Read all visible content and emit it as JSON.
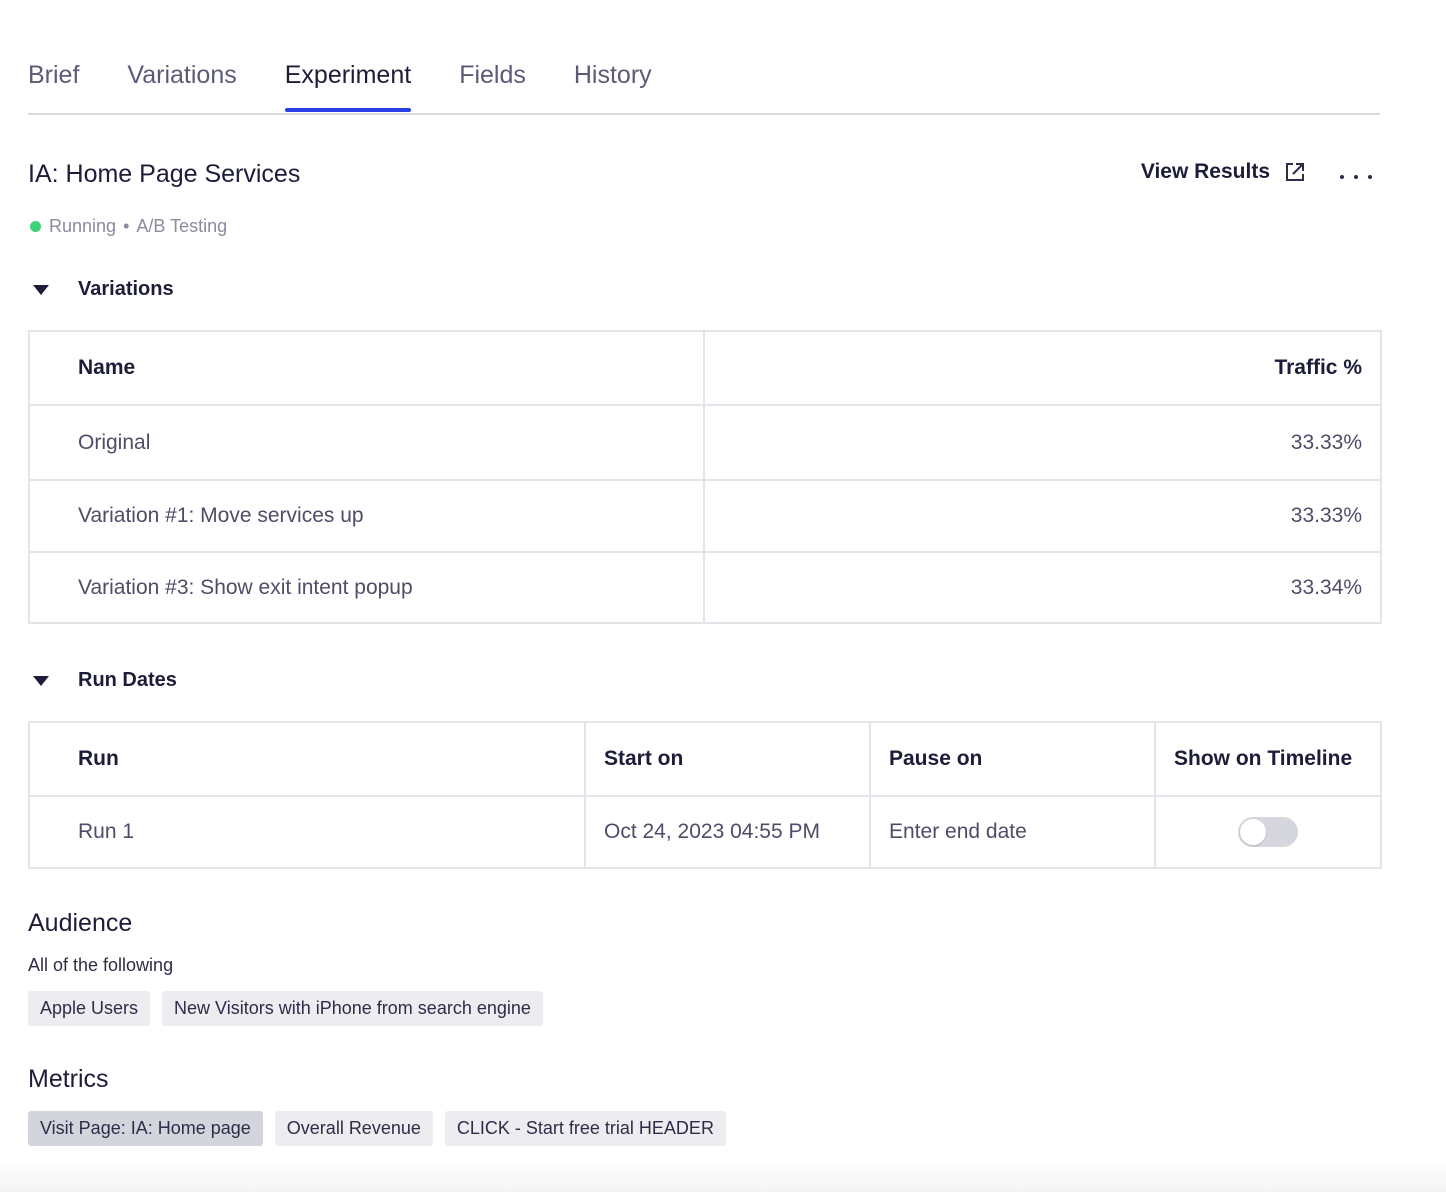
{
  "tabs": [
    {
      "label": "Brief",
      "active": false
    },
    {
      "label": "Variations",
      "active": false
    },
    {
      "label": "Experiment",
      "active": true
    },
    {
      "label": "Fields",
      "active": false
    },
    {
      "label": "History",
      "active": false
    }
  ],
  "header": {
    "title": "IA: Home Page Services",
    "view_results_label": "View Results",
    "status": "Running",
    "status_separator": "•",
    "type": "A/B Testing",
    "status_color": "#3fd07a"
  },
  "variations": {
    "section_title": "Variations",
    "columns": {
      "name": "Name",
      "traffic": "Traffic %"
    },
    "rows": [
      {
        "name": "Original",
        "traffic": "33.33%"
      },
      {
        "name": "Variation #1: Move services up",
        "traffic": "33.33%"
      },
      {
        "name": "Variation #3: Show exit intent popup",
        "traffic": "33.34%"
      }
    ]
  },
  "run_dates": {
    "section_title": "Run Dates",
    "columns": {
      "run": "Run",
      "start": "Start on",
      "pause": "Pause on",
      "timeline": "Show on Timeline"
    },
    "rows": [
      {
        "run": "Run 1",
        "start": "Oct 24, 2023 04:55 PM",
        "pause_placeholder": "Enter end date",
        "show_on_timeline": false
      }
    ]
  },
  "audience": {
    "title": "Audience",
    "subtitle": "All of the following",
    "chips": [
      "Apple Users",
      "New Visitors with iPhone from search engine"
    ]
  },
  "metrics": {
    "title": "Metrics",
    "chips": [
      "Visit Page: IA: Home page",
      "Overall Revenue",
      "CLICK - Start free trial HEADER"
    ]
  },
  "colors": {
    "accent": "#2b3fe6",
    "text": "#1d1d3a",
    "chip_bg": "#ececf1"
  }
}
